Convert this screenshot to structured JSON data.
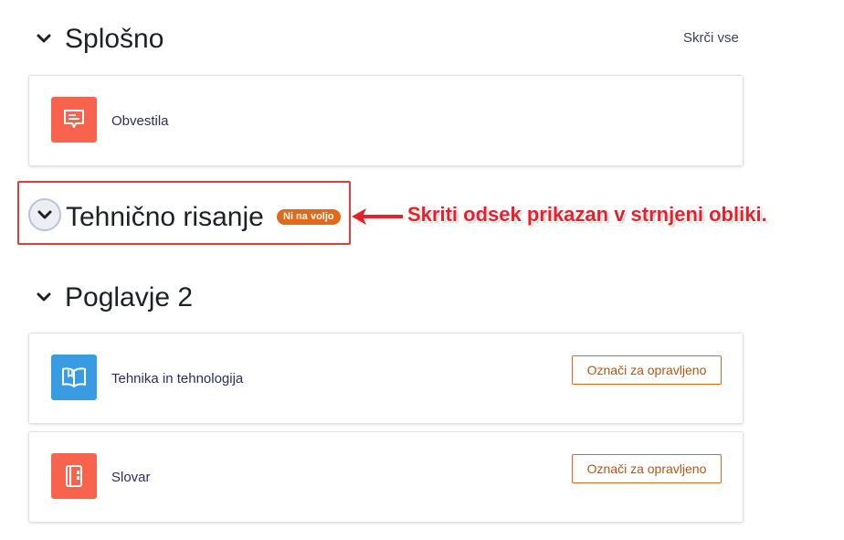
{
  "header": {
    "collapse_all": "Skrči vse"
  },
  "sections": [
    {
      "title": "Splošno",
      "activities": [
        {
          "name": "Obvestila",
          "icon": "announcement-icon",
          "icon_color": "#f7634d"
        }
      ]
    },
    {
      "title": "Tehnično risanje",
      "badge": "Ni na voljo",
      "collapsed": true
    },
    {
      "title": "Poglavje 2",
      "activities": [
        {
          "name": "Tehnika in tehnologija",
          "icon": "book-icon",
          "icon_color": "#399be2",
          "button": "Označi za opravljeno"
        },
        {
          "name": "Slovar",
          "icon": "glossary-icon",
          "icon_color": "#f7634d",
          "button": "Označi za opravljeno"
        }
      ]
    }
  ],
  "annotation": {
    "text": "Skriti odsek prikazan v strnjeni obliki.",
    "color": "#e8202a"
  },
  "colors": {
    "accent_orange": "#e0691a",
    "link": "#3d3d6b"
  }
}
